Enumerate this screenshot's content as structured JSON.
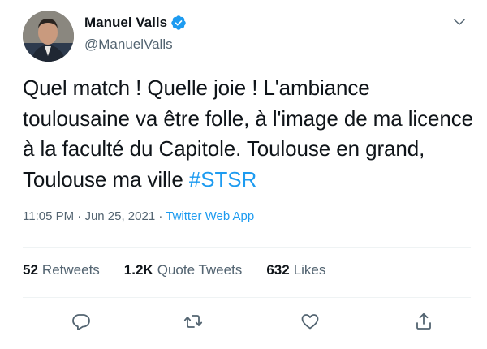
{
  "author": {
    "display_name": "Manuel Valls",
    "handle": "@ManuelValls",
    "verified": true
  },
  "tweet": {
    "text": "Quel match ! Quelle joie ! L'ambiance toulousaine va être folle, à l'image de ma licence à la faculté du Capitole. Toulouse en grand, Toulouse ma ville ",
    "hashtag": "#STSR"
  },
  "meta": {
    "time": "11:05 PM",
    "separator": "·",
    "date": "Jun 25, 2021",
    "source": "Twitter Web App"
  },
  "stats": {
    "retweets_count": "52",
    "retweets_label": "Retweets",
    "quote_count": "1.2K",
    "quote_label": "Quote Tweets",
    "likes_count": "632",
    "likes_label": "Likes"
  },
  "icons": {
    "more": "chevron-down-icon",
    "reply": "reply-icon",
    "retweet": "retweet-icon",
    "like": "heart-icon",
    "share": "share-icon",
    "verified": "verified-badge-icon"
  },
  "colors": {
    "accent": "#1d9bf0",
    "text": "#0f1419",
    "muted": "#536471"
  }
}
